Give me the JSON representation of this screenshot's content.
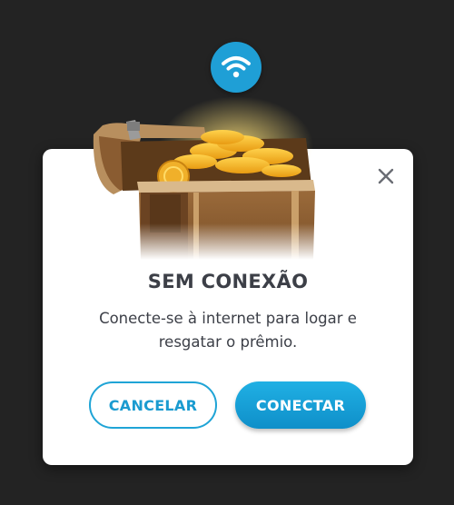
{
  "dialog": {
    "title": "SEM CONEXÃO",
    "message": "Conecte-se à internet para logar e resgatar o prêmio.",
    "cancel_label": "CANCELAR",
    "connect_label": "CONECTAR"
  },
  "icons": {
    "badge": "wifi-icon",
    "close": "close-icon",
    "illustration": "treasure-chest-icon"
  },
  "colors": {
    "background": "#232323",
    "accent": "#1f9fd6",
    "text": "#3c3f47",
    "card": "#ffffff"
  }
}
